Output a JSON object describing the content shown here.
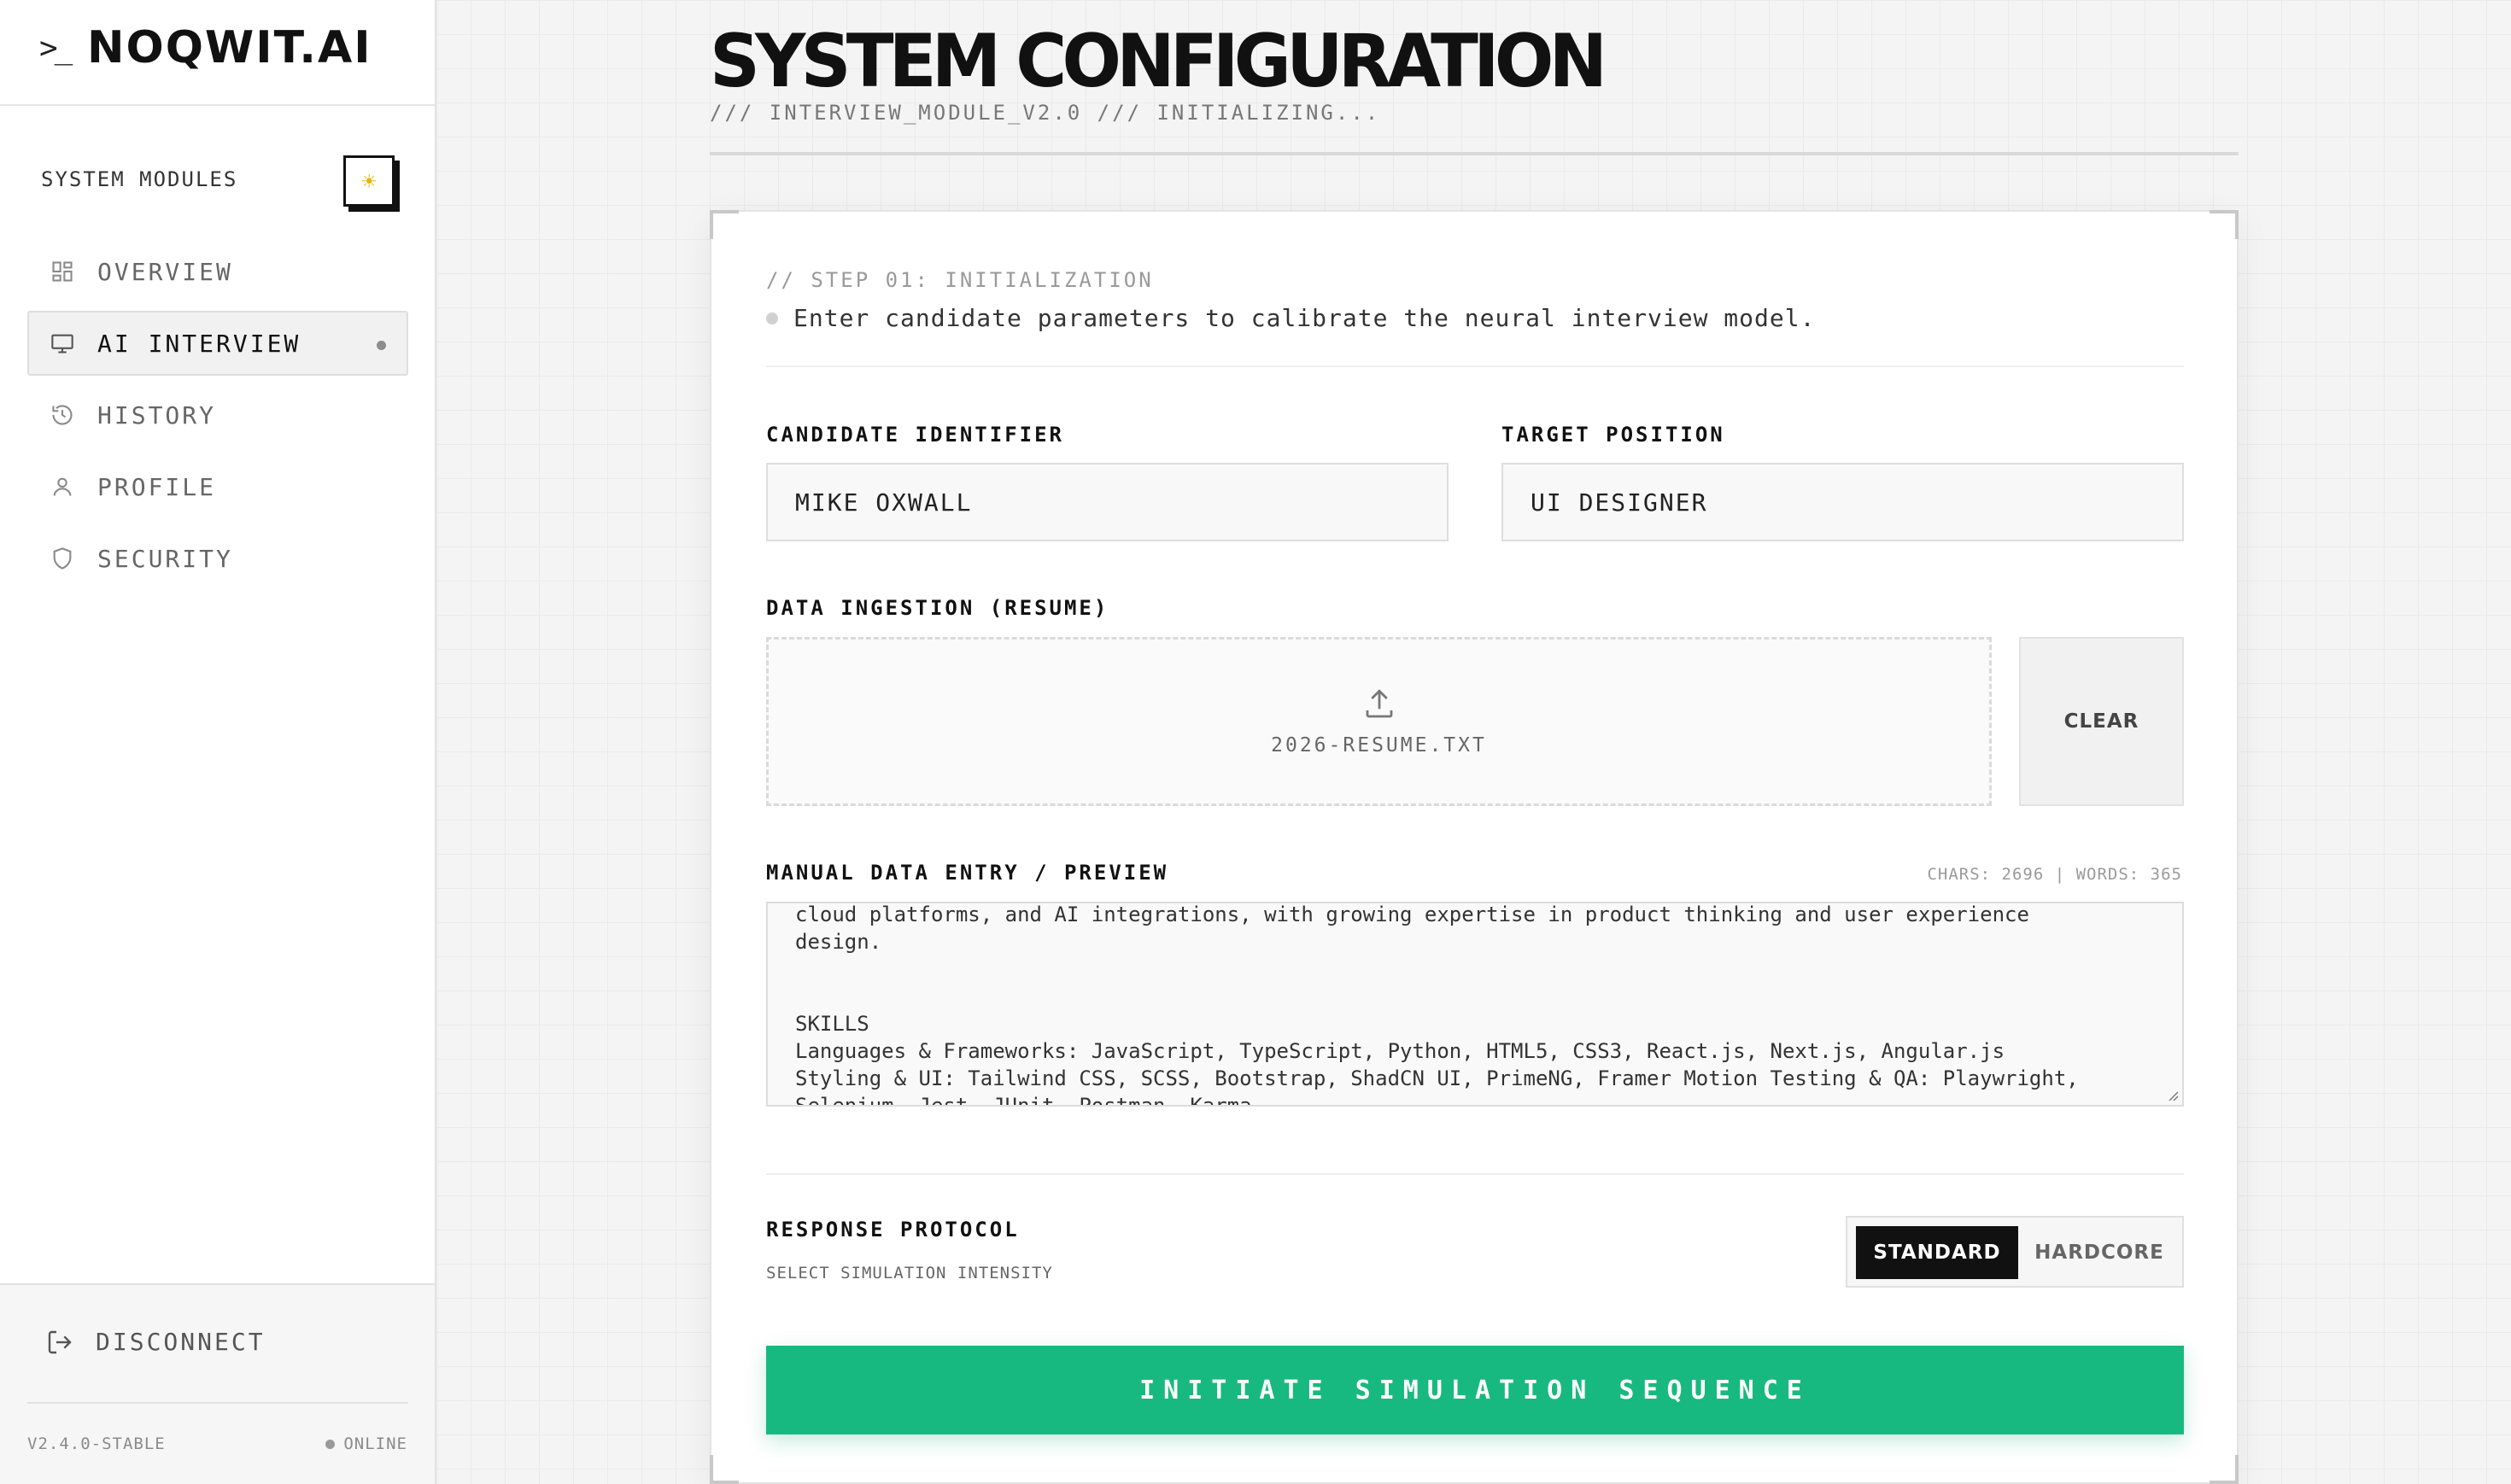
{
  "brand": {
    "name": "NOQWIT.AI"
  },
  "sidebar": {
    "modules_title": "SYSTEM MODULES",
    "items": [
      {
        "label": "OVERVIEW",
        "icon": "grid-icon"
      },
      {
        "label": "AI INTERVIEW",
        "icon": "monitor-icon",
        "active": true
      },
      {
        "label": "HISTORY",
        "icon": "history-icon"
      },
      {
        "label": "PROFILE",
        "icon": "user-icon"
      },
      {
        "label": "SECURITY",
        "icon": "shield-icon"
      }
    ],
    "disconnect_label": "DISCONNECT",
    "version": "V2.4.0-STABLE",
    "status": "ONLINE"
  },
  "header": {
    "title": "SYSTEM CONFIGURATION",
    "subtitle": "/// INTERVIEW_MODULE_V2.0 /// INITIALIZING..."
  },
  "form": {
    "step_label": "// STEP 01: INITIALIZATION",
    "step_description": "Enter candidate parameters to calibrate the neural interview model.",
    "candidate_label": "CANDIDATE IDENTIFIER",
    "candidate_value": "MIKE OXWALL",
    "position_label": "TARGET POSITION",
    "position_value": "UI DESIGNER",
    "data_ingestion_label": "DATA INGESTION (RESUME)",
    "file_name": "2026-RESUME.TXT",
    "clear_label": "CLEAR",
    "manual_label": "MANUAL DATA ENTRY / PREVIEW",
    "counts": "CHARS: 2696 | WORDS: 365",
    "resume_text": "cloud platforms, and AI integrations, with growing expertise in product thinking and user experience\ndesign.\n\n\nSKILLS\nLanguages & Frameworks: JavaScript, TypeScript, Python, HTML5, CSS3, React.js, Next.js, Angular.js\nStyling & UI: Tailwind CSS, SCSS, Bootstrap, ShadCN UI, PrimeNG, Framer Motion Testing & QA: Playwright,\nSelenium, Jest, JUnit, Postman, Karma",
    "response_label": "RESPONSE PROTOCOL",
    "response_sub": "SELECT SIMULATION INTENSITY",
    "mode_standard": "STANDARD",
    "mode_hardcore": "HARDCORE",
    "selected_mode": "STANDARD",
    "cta_label": "INITIATE SIMULATION SEQUENCE"
  },
  "colors": {
    "accent": "#17b981",
    "dark": "#111111"
  }
}
